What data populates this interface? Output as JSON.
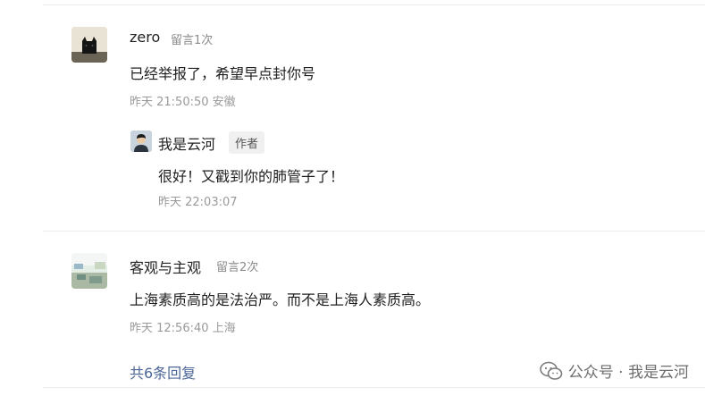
{
  "comments": [
    {
      "nickname": "zero",
      "count_badge": "留言1次",
      "content": "已经举报了，希望早点封你号",
      "time_location": "昨天 21:50:50 安徽",
      "reply": {
        "nickname": "我是云河",
        "author_tag": "作者",
        "content": "很好！又戳到你的肺管子了！",
        "time": "昨天 22:03:07"
      }
    },
    {
      "nickname": "客观与主观",
      "count_badge": "留言2次",
      "content": "上海素质高的是法治严。而不是上海人素质高。",
      "time_location": "昨天 12:56:40 上海",
      "replies_link": "共6条回复"
    }
  ],
  "watermark": {
    "text": "公众号 · 我是云河"
  }
}
